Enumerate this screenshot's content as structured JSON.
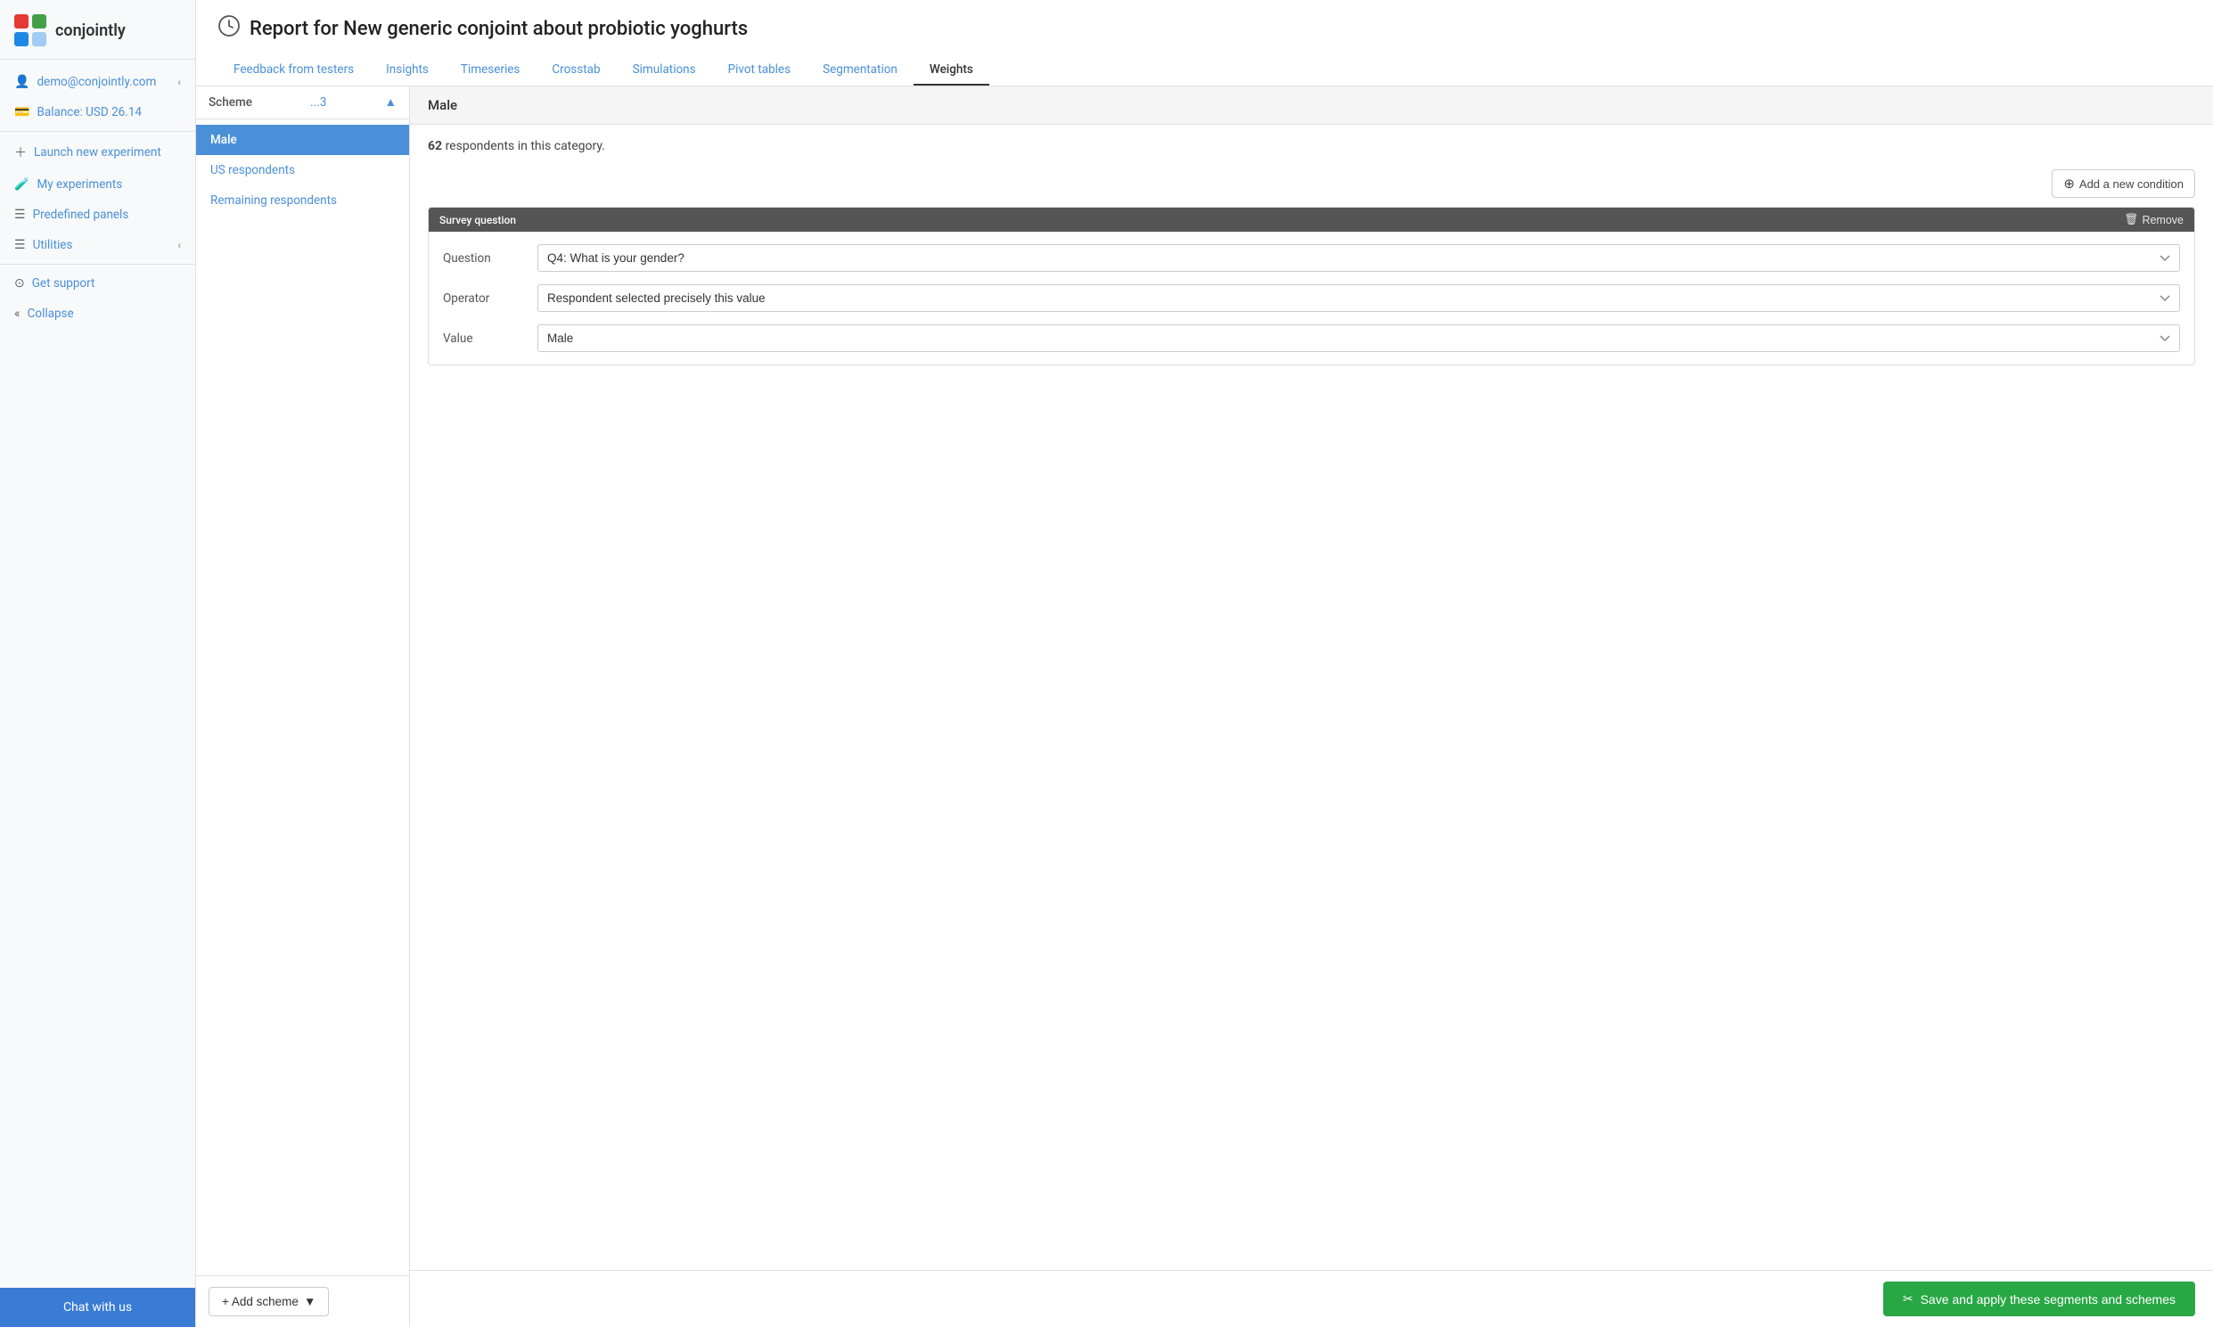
{
  "sidebar": {
    "logo_text": "conjointly",
    "items": [
      {
        "id": "user",
        "label": "demo@conjointly.com",
        "icon": "👤",
        "chevron": "‹"
      },
      {
        "id": "balance",
        "label": "Balance: USD 26.14",
        "icon": "🏷",
        "chevron": ""
      },
      {
        "id": "launch",
        "label": "Launch new experiment",
        "icon": "+",
        "chevron": ""
      },
      {
        "id": "experiments",
        "label": "My experiments",
        "icon": "🧪",
        "chevron": ""
      },
      {
        "id": "panels",
        "label": "Predefined panels",
        "icon": "☰",
        "chevron": ""
      },
      {
        "id": "utilities",
        "label": "Utilities",
        "icon": "☰",
        "chevron": "‹"
      },
      {
        "id": "support",
        "label": "Get support",
        "icon": "⊙",
        "chevron": ""
      },
      {
        "id": "collapse",
        "label": "Collapse",
        "icon": "«",
        "chevron": ""
      }
    ],
    "chat_label": "Chat with us"
  },
  "header": {
    "title_icon": "☎",
    "title": "Report for New generic conjoint about probiotic yoghurts",
    "tabs": [
      {
        "id": "feedback",
        "label": "Feedback from testers",
        "active": false
      },
      {
        "id": "insights",
        "label": "Insights",
        "active": false
      },
      {
        "id": "timeseries",
        "label": "Timeseries",
        "active": false
      },
      {
        "id": "crosstab",
        "label": "Crosstab",
        "active": false
      },
      {
        "id": "simulations",
        "label": "Simulations",
        "active": false
      },
      {
        "id": "pivot",
        "label": "Pivot tables",
        "active": false
      },
      {
        "id": "segmentation",
        "label": "Segmentation",
        "active": false
      },
      {
        "id": "weights",
        "label": "Weights",
        "active": true
      }
    ]
  },
  "scheme_panel": {
    "label": "Scheme",
    "count": "...3",
    "chevron": "▲",
    "items": [
      {
        "id": "male",
        "label": "Male",
        "active": true
      },
      {
        "id": "us",
        "label": "US respondents",
        "active": false
      },
      {
        "id": "remaining",
        "label": "Remaining respondents",
        "active": false
      }
    ],
    "add_scheme_label": "+ Add scheme",
    "add_scheme_chevron": "▼"
  },
  "segment": {
    "title": "Male",
    "respondent_count": "62",
    "respondent_label": "respondents in this category.",
    "add_condition_label": "Add a new condition",
    "block_label": "Survey question",
    "remove_label": "Remove",
    "fields": [
      {
        "id": "question",
        "label": "Question",
        "value": "Q4: What is your gender?",
        "options": [
          "Q4: What is your gender?"
        ]
      },
      {
        "id": "operator",
        "label": "Operator",
        "value": "Respondent selected precisely this value",
        "options": [
          "Respondent selected precisely this value"
        ]
      },
      {
        "id": "value",
        "label": "Value",
        "value": "Male",
        "options": [
          "Male"
        ]
      }
    ]
  },
  "footer": {
    "save_label": "Save and apply these segments and schemes"
  }
}
